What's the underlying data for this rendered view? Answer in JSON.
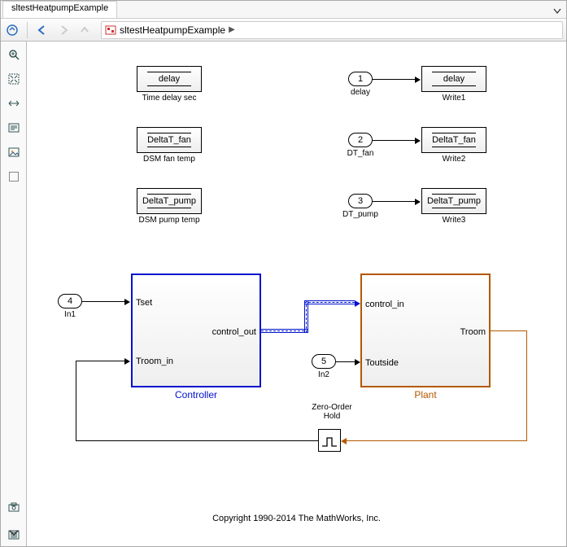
{
  "tab": {
    "title": "sltestHeatpumpExample"
  },
  "breadcrumb": {
    "model": "sltestHeatpumpExample"
  },
  "blocks": {
    "delay": {
      "text": "delay",
      "caption": "Time delay sec"
    },
    "dtfan": {
      "text": "DeltaT_fan",
      "caption": "DSM fan temp"
    },
    "dtpump": {
      "text": "DeltaT_pump",
      "caption": "DSM pump temp"
    },
    "wdelay": {
      "text": "delay",
      "caption": "Write1"
    },
    "wdtfan": {
      "text": "DeltaT_fan",
      "caption": "Write2"
    },
    "wdtpump": {
      "text": "DeltaT_pump",
      "caption": "Write3"
    }
  },
  "inports": {
    "p1": {
      "num": "1",
      "label": "delay"
    },
    "p2": {
      "num": "2",
      "label": "DT_fan"
    },
    "p3": {
      "num": "3",
      "label": "DT_pump"
    },
    "p4": {
      "num": "4",
      "label": "In1"
    },
    "p5": {
      "num": "5",
      "label": "In2"
    }
  },
  "controller": {
    "name": "Controller",
    "in1": "Tset",
    "in2": "Troom_in",
    "out": "control_out"
  },
  "plant": {
    "name": "Plant",
    "in1": "control_in",
    "in2": "Toutside",
    "out": "Troom"
  },
  "zoh": {
    "label": "Zero-Order\nHold"
  },
  "copyright": "Copyright 1990-2014 The MathWorks, Inc."
}
